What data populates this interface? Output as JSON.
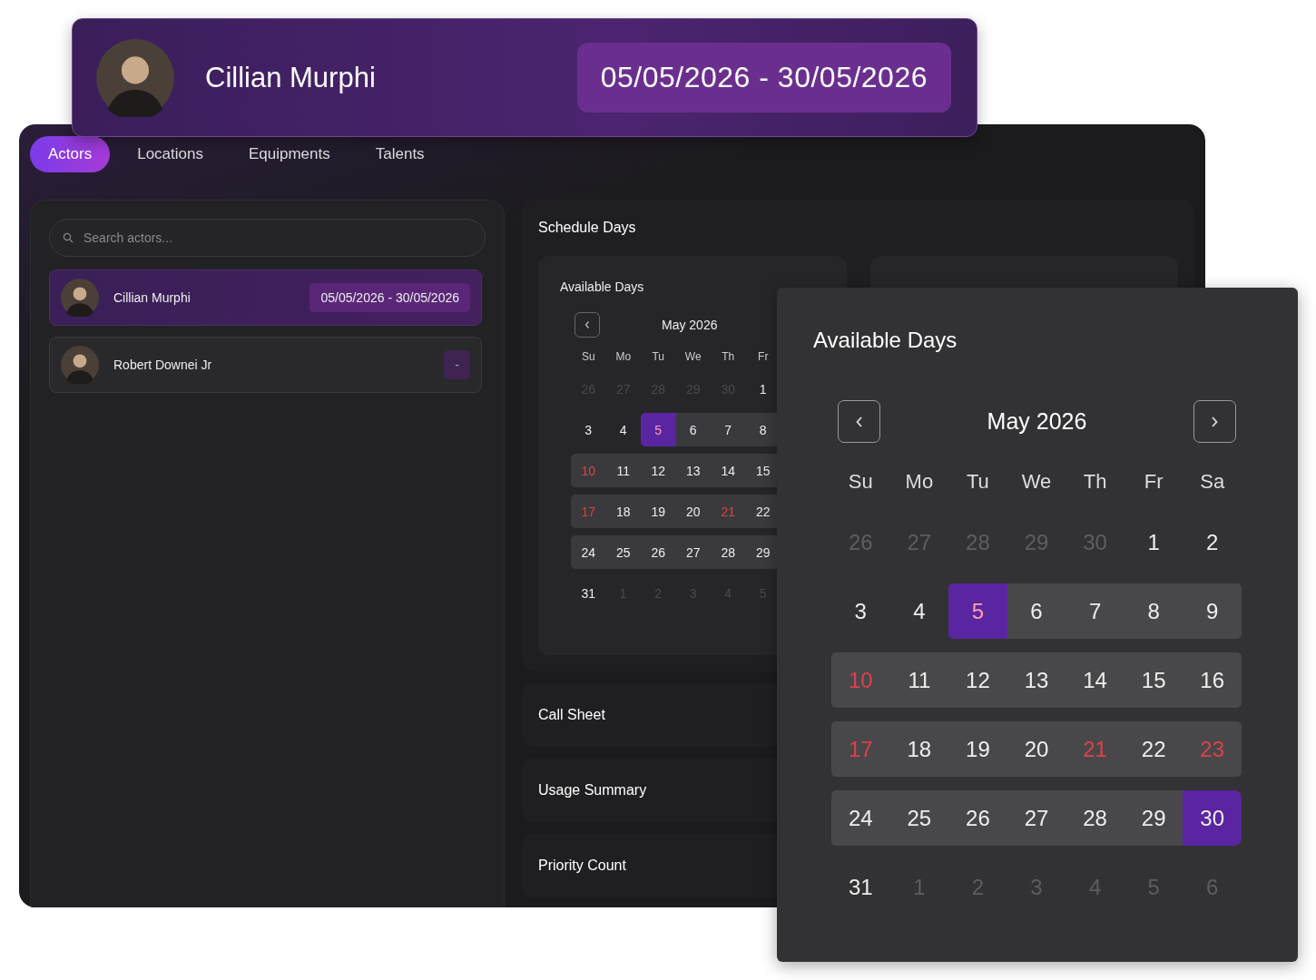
{
  "header": {
    "name": "Cillian Murphi",
    "date_range": "05/05/2026 - 30/05/2026"
  },
  "tabs": [
    {
      "label": "Actors",
      "selected": true
    },
    {
      "label": "Locations",
      "selected": false
    },
    {
      "label": "Equipments",
      "selected": false
    },
    {
      "label": "Talents",
      "selected": false
    }
  ],
  "search": {
    "placeholder": "Search actors..."
  },
  "actors": [
    {
      "name": "Cillian Murphi",
      "date_range": "05/05/2026 - 30/05/2026",
      "selected": true
    },
    {
      "name": "Robert Downei Jr",
      "date_range": "-",
      "selected": false
    }
  ],
  "schedule": {
    "title": "Schedule Days",
    "calendar": {
      "title": "Available Days",
      "month": "May 2026",
      "weekdays": [
        "Su",
        "Mo",
        "Tu",
        "We",
        "Th",
        "Fr"
      ],
      "weeks": [
        [
          {
            "day": "26",
            "kind": "outside"
          },
          {
            "day": "27",
            "kind": "outside"
          },
          {
            "day": "28",
            "kind": "outside"
          },
          {
            "day": "29",
            "kind": "outside"
          },
          {
            "day": "30",
            "kind": "outside"
          },
          {
            "day": "1",
            "kind": "plain",
            "unavailable": false
          }
        ],
        [
          {
            "day": "3",
            "kind": "plain",
            "unavailable": false
          },
          {
            "day": "4",
            "kind": "plain",
            "unavailable": false
          },
          {
            "day": "5",
            "kind": "start",
            "unavailable": true
          },
          {
            "day": "6",
            "kind": "range",
            "unavailable": false
          },
          {
            "day": "7",
            "kind": "range",
            "unavailable": false
          },
          {
            "day": "8",
            "kind": "range",
            "unavailable": false
          }
        ],
        [
          {
            "day": "10",
            "kind": "range",
            "unavailable": true
          },
          {
            "day": "11",
            "kind": "range",
            "unavailable": false
          },
          {
            "day": "12",
            "kind": "range",
            "unavailable": false
          },
          {
            "day": "13",
            "kind": "range",
            "unavailable": false
          },
          {
            "day": "14",
            "kind": "range",
            "unavailable": false
          },
          {
            "day": "15",
            "kind": "range",
            "unavailable": false
          }
        ],
        [
          {
            "day": "17",
            "kind": "range",
            "unavailable": true
          },
          {
            "day": "18",
            "kind": "range",
            "unavailable": false
          },
          {
            "day": "19",
            "kind": "range",
            "unavailable": false
          },
          {
            "day": "20",
            "kind": "range",
            "unavailable": false
          },
          {
            "day": "21",
            "kind": "range",
            "unavailable": true
          },
          {
            "day": "22",
            "kind": "range",
            "unavailable": false
          }
        ],
        [
          {
            "day": "24",
            "kind": "range",
            "unavailable": false
          },
          {
            "day": "25",
            "kind": "range",
            "unavailable": false
          },
          {
            "day": "26",
            "kind": "range",
            "unavailable": false
          },
          {
            "day": "27",
            "kind": "range",
            "unavailable": false
          },
          {
            "day": "28",
            "kind": "range",
            "unavailable": false
          },
          {
            "day": "29",
            "kind": "range",
            "unavailable": false
          }
        ],
        [
          {
            "day": "31",
            "kind": "plain",
            "unavailable": false
          },
          {
            "day": "1",
            "kind": "outside"
          },
          {
            "day": "2",
            "kind": "outside"
          },
          {
            "day": "3",
            "kind": "outside"
          },
          {
            "day": "4",
            "kind": "outside"
          },
          {
            "day": "5",
            "kind": "outside"
          }
        ]
      ]
    }
  },
  "sections": [
    "Call Sheet",
    "Usage Summary",
    "Priority Count"
  ],
  "popup": {
    "title": "Available Days",
    "month": "May 2026",
    "weekdays": [
      "Su",
      "Mo",
      "Tu",
      "We",
      "Th",
      "Fr",
      "Sa"
    ],
    "weeks": [
      [
        {
          "day": "26",
          "kind": "outside"
        },
        {
          "day": "27",
          "kind": "outside"
        },
        {
          "day": "28",
          "kind": "outside"
        },
        {
          "day": "29",
          "kind": "outside"
        },
        {
          "day": "30",
          "kind": "outside"
        },
        {
          "day": "1",
          "kind": "plain",
          "unavailable": false
        },
        {
          "day": "2",
          "kind": "plain",
          "unavailable": false
        }
      ],
      [
        {
          "day": "3",
          "kind": "plain",
          "unavailable": false
        },
        {
          "day": "4",
          "kind": "plain",
          "unavailable": false
        },
        {
          "day": "5",
          "kind": "start",
          "unavailable": true
        },
        {
          "day": "6",
          "kind": "range",
          "unavailable": false
        },
        {
          "day": "7",
          "kind": "range",
          "unavailable": false
        },
        {
          "day": "8",
          "kind": "range",
          "unavailable": false
        },
        {
          "day": "9",
          "kind": "range",
          "unavailable": false
        }
      ],
      [
        {
          "day": "10",
          "kind": "range",
          "unavailable": true
        },
        {
          "day": "11",
          "kind": "range",
          "unavailable": false
        },
        {
          "day": "12",
          "kind": "range",
          "unavailable": false
        },
        {
          "day": "13",
          "kind": "range",
          "unavailable": false
        },
        {
          "day": "14",
          "kind": "range",
          "unavailable": false
        },
        {
          "day": "15",
          "kind": "range",
          "unavailable": false
        },
        {
          "day": "16",
          "kind": "range",
          "unavailable": false
        }
      ],
      [
        {
          "day": "17",
          "kind": "range",
          "unavailable": true
        },
        {
          "day": "18",
          "kind": "range",
          "unavailable": false
        },
        {
          "day": "19",
          "kind": "range",
          "unavailable": false
        },
        {
          "day": "20",
          "kind": "range",
          "unavailable": false
        },
        {
          "day": "21",
          "kind": "range",
          "unavailable": true
        },
        {
          "day": "22",
          "kind": "range",
          "unavailable": false
        },
        {
          "day": "23",
          "kind": "range",
          "unavailable": true
        }
      ],
      [
        {
          "day": "24",
          "kind": "range",
          "unavailable": false
        },
        {
          "day": "25",
          "kind": "range",
          "unavailable": false
        },
        {
          "day": "26",
          "kind": "range",
          "unavailable": false
        },
        {
          "day": "27",
          "kind": "range",
          "unavailable": false
        },
        {
          "day": "28",
          "kind": "range",
          "unavailable": false
        },
        {
          "day": "29",
          "kind": "range",
          "unavailable": false
        },
        {
          "day": "30",
          "kind": "end",
          "unavailable": false
        }
      ],
      [
        {
          "day": "31",
          "kind": "plain",
          "unavailable": false
        },
        {
          "day": "1",
          "kind": "outside"
        },
        {
          "day": "2",
          "kind": "outside"
        },
        {
          "day": "3",
          "kind": "outside"
        },
        {
          "day": "4",
          "kind": "outside"
        },
        {
          "day": "5",
          "kind": "outside"
        },
        {
          "day": "6",
          "kind": "outside"
        }
      ]
    ]
  }
}
